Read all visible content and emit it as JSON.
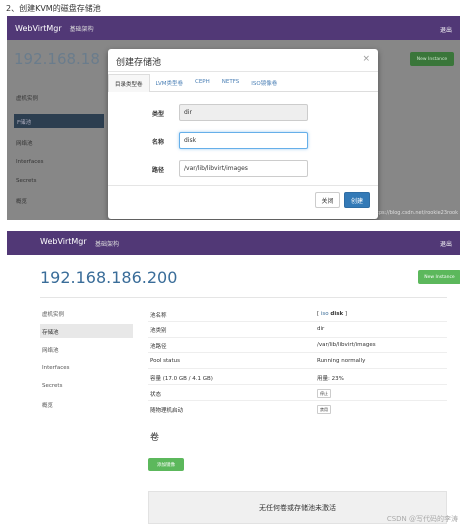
{
  "heading": "2、创建KVM的磁盘存储池",
  "app": {
    "brand": "WebVirtMgr",
    "nav_link": "基础架构",
    "logout": "退出",
    "host_ip": "192.168.18",
    "host_ip_full": "192.168.186.200",
    "new_instance": "New Instance",
    "nav_color": "#513876"
  },
  "sidebar1": [
    "虚机实例",
    "F储池",
    "网络池",
    "Interfaces",
    "Secrets",
    "概览"
  ],
  "sidebar2": [
    "虚机实例",
    "存储池",
    "网络池",
    "Interfaces",
    "Secrets",
    "概览"
  ],
  "watermark1": "https://blog.csdn.net/rookie23rook",
  "modal": {
    "title": "创建存储池",
    "close_icon": "×",
    "tabs": [
      "目录类型卷",
      "LVM类型卷",
      "CEPH",
      "NETFS",
      "ISO镜像卷"
    ],
    "type_label": "类型",
    "type_value": "dir",
    "name_label": "名称",
    "name_value": "disk",
    "path_label": "路径",
    "path_value": "/var/lib/libvirt/images",
    "close_button": "关闭",
    "create_button": "创建"
  },
  "details": {
    "rows": [
      {
        "key": "池名称",
        "value": "[ iso disk ]"
      },
      {
        "key": "池类别",
        "value": "dir"
      },
      {
        "key": "池路径",
        "value": "/var/lib/libvirt/images"
      },
      {
        "key": "Pool status",
        "value": "Running normally"
      },
      {
        "key": "容量 (17.0 GB / 4.1 GB)",
        "value": "用量: 23%"
      },
      {
        "key": "状态",
        "value": "停止"
      },
      {
        "key": "随物理机启动",
        "value": "禁用"
      }
    ],
    "pool_name_link": "iso",
    "pool_name_bold": "disk",
    "volumes_heading": "卷",
    "add_volume": "添加镜像",
    "empty_message": "无任何卷或存储池未激活"
  },
  "watermark2": "CSDN @写代码的李涛"
}
